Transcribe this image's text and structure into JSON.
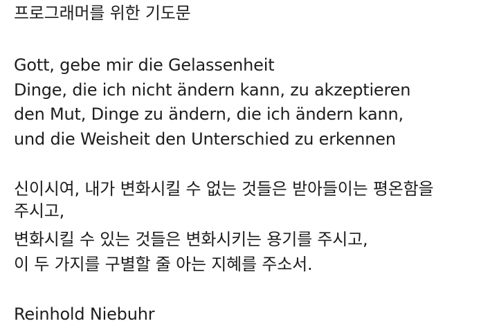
{
  "title": "프로그래머를 위한 기도문",
  "german_prayer": {
    "lines": [
      "Gott, gebe mir die Gelassenheit",
      "Dinge, die ich nicht ändern kann, zu akzeptieren",
      "den Mut, Dinge zu ändern, die ich ändern kann,",
      "und die Weisheit den Unterschied zu erkennen"
    ]
  },
  "korean_prayer": {
    "lines": [
      "신이시여, 내가 변화시킬 수 없는 것들은 받아들이는 평온함을",
      "주시고,",
      "변화시킬 수 있는 것들은 변화시키는 용기를 주시고,",
      "이 두 가지를 구별할 줄 아는 지혜를 주소서."
    ]
  },
  "author": "Reinhold Niebuhr",
  "colors": {
    "text": "#1d1d1d",
    "background": "#ffffff"
  }
}
